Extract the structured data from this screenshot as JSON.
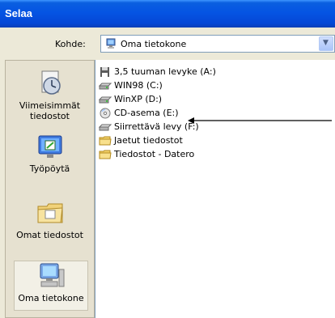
{
  "window": {
    "title": "Selaa"
  },
  "lookin": {
    "label": "Kohde:",
    "value": "Oma tietokone",
    "dropdown_glyph": "▼"
  },
  "places": [
    {
      "label": "Viimeisimmät tiedostot",
      "icon": "recent-documents-icon"
    },
    {
      "label": "Työpöytä",
      "icon": "desktop-icon"
    },
    {
      "label": "Omat tiedostot",
      "icon": "my-documents-icon"
    },
    {
      "label": "Oma tietokone",
      "icon": "my-computer-icon",
      "selected": true
    }
  ],
  "items": [
    {
      "label": "3,5 tuuman levyke (A:)",
      "icon": "floppy-drive-icon"
    },
    {
      "label": "WIN98 (C:)",
      "icon": "hard-drive-icon"
    },
    {
      "label": "WinXP (D:)",
      "icon": "hard-drive-icon"
    },
    {
      "label": "CD-asema (E:)",
      "icon": "cd-drive-icon"
    },
    {
      "label": "Siirrettävä levy (F:)",
      "icon": "removable-drive-icon"
    },
    {
      "label": "Jaetut tiedostot",
      "icon": "folder-icon"
    },
    {
      "label": "Tiedostot - Datero",
      "icon": "folder-icon"
    }
  ],
  "colors": {
    "title_bar": "#0554e3",
    "panel": "#ece9d8",
    "accent_border": "#7f9db9"
  }
}
